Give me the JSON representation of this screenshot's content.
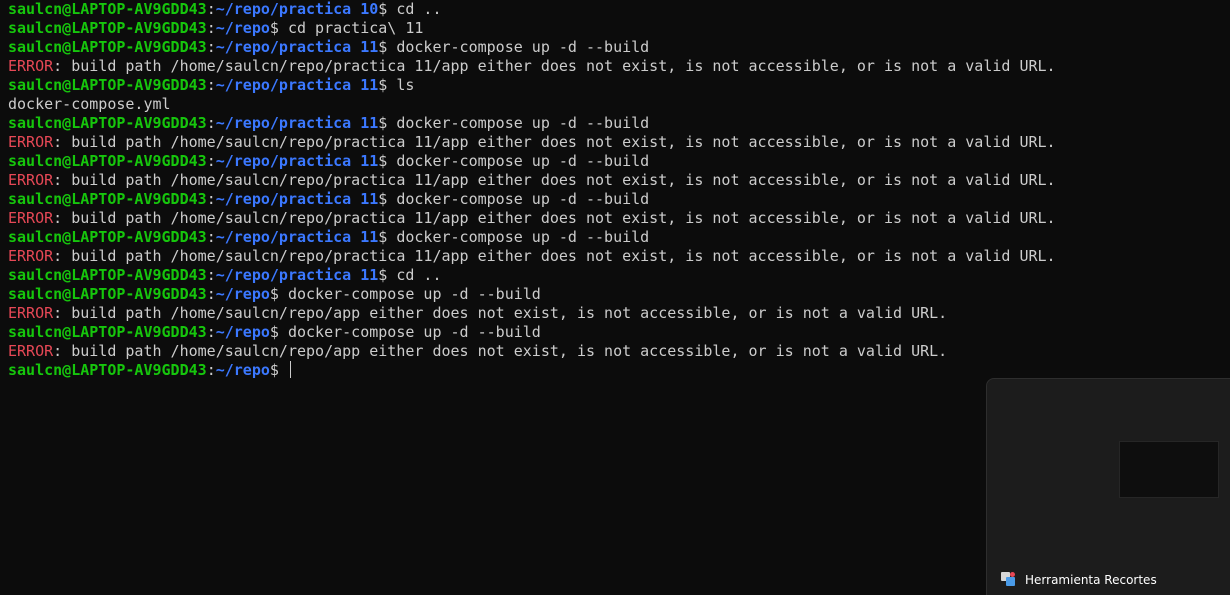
{
  "prompt": {
    "user": "saulcn@LAPTOP-AV9GDD43",
    "colon": ":",
    "dollar": "$"
  },
  "lines": [
    {
      "type": "prompt",
      "path": "~/repo/practica 10",
      "command": " cd .."
    },
    {
      "type": "prompt",
      "path": "~/repo",
      "command": " cd practica\\ 11"
    },
    {
      "type": "prompt",
      "path": "~/repo/practica 11",
      "command": " docker-compose up -d --build"
    },
    {
      "type": "error",
      "label": "ERROR",
      "message": ": build path /home/saulcn/repo/practica 11/app either does not exist, is not accessible, or is not a valid URL."
    },
    {
      "type": "prompt",
      "path": "~/repo/practica 11",
      "command": " ls"
    },
    {
      "type": "output",
      "text": "docker-compose.yml"
    },
    {
      "type": "prompt",
      "path": "~/repo/practica 11",
      "command": " docker-compose up -d --build"
    },
    {
      "type": "error",
      "label": "ERROR",
      "message": ": build path /home/saulcn/repo/practica 11/app either does not exist, is not accessible, or is not a valid URL."
    },
    {
      "type": "prompt",
      "path": "~/repo/practica 11",
      "command": " docker-compose up -d --build"
    },
    {
      "type": "error",
      "label": "ERROR",
      "message": ": build path /home/saulcn/repo/practica 11/app either does not exist, is not accessible, or is not a valid URL."
    },
    {
      "type": "prompt",
      "path": "~/repo/practica 11",
      "command": " docker-compose up -d --build"
    },
    {
      "type": "error",
      "label": "ERROR",
      "message": ": build path /home/saulcn/repo/practica 11/app either does not exist, is not accessible, or is not a valid URL."
    },
    {
      "type": "prompt",
      "path": "~/repo/practica 11",
      "command": " docker-compose up -d --build"
    },
    {
      "type": "error",
      "label": "ERROR",
      "message": ": build path /home/saulcn/repo/practica 11/app either does not exist, is not accessible, or is not a valid URL."
    },
    {
      "type": "prompt",
      "path": "~/repo/practica 11",
      "command": " cd .."
    },
    {
      "type": "prompt",
      "path": "~/repo",
      "command": " docker-compose up -d --build"
    },
    {
      "type": "error",
      "label": "ERROR",
      "message": ": build path /home/saulcn/repo/app either does not exist, is not accessible, or is not a valid URL."
    },
    {
      "type": "prompt",
      "path": "~/repo",
      "command": " docker-compose up -d --build"
    },
    {
      "type": "error",
      "label": "ERROR",
      "message": ": build path /home/saulcn/repo/app either does not exist, is not accessible, or is not a valid URL."
    },
    {
      "type": "prompt",
      "path": "~/repo",
      "command": " ",
      "cursor": true
    }
  ],
  "snip_notification": {
    "app_name": "Herramienta Recortes",
    "icon": "snipping-tool-icon"
  },
  "colors": {
    "background": "#0c0c0c",
    "user": "#16c60c",
    "path": "#3b78ff",
    "error": "#e74856",
    "text": "#cccccc"
  }
}
